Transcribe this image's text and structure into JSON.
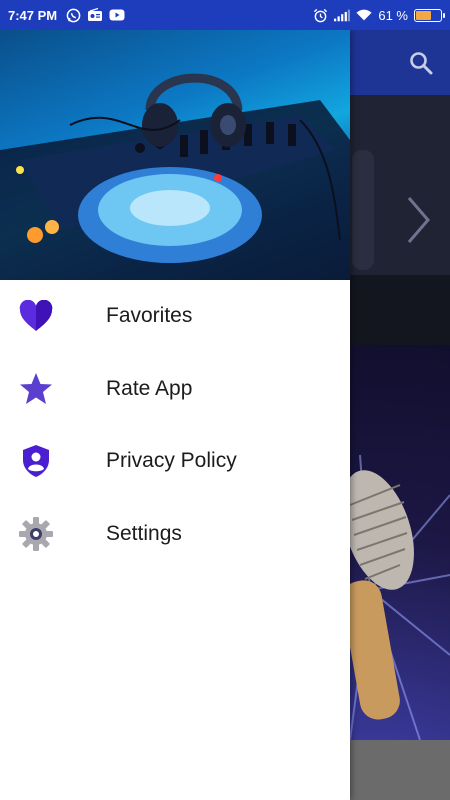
{
  "status_bar": {
    "time": "7:47 PM",
    "battery_percent": "61 %",
    "battery_level": 0.61,
    "left_icons": [
      "whatsapp-icon",
      "radio-icon",
      "youtube-icon"
    ],
    "right_icons": [
      "alarm-icon",
      "signal-icon",
      "wifi-icon"
    ]
  },
  "drawer": {
    "header_image": "dj-mixer-headphones",
    "items": [
      {
        "label": "Favorites",
        "icon": "heart-icon"
      },
      {
        "label": "Rate App",
        "icon": "star-icon"
      },
      {
        "label": "Privacy Policy",
        "icon": "shield-user-icon"
      },
      {
        "label": "Settings",
        "icon": "gear-icon"
      }
    ]
  },
  "colors": {
    "status_bar": "#1e3dbd",
    "toolbar": "#1f3595",
    "accent": "#5b2be0",
    "star": "#5b3fcf"
  }
}
